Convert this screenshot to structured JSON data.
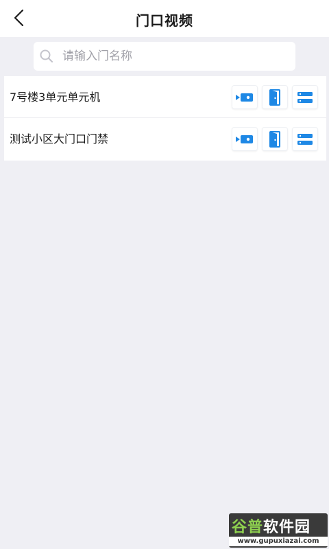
{
  "header": {
    "title": "门口视频",
    "back_icon": "chevron-left-icon"
  },
  "search": {
    "placeholder": "请输入门名称",
    "value": "",
    "icon": "search-icon"
  },
  "doors": [
    {
      "name": "7号楼3单元单元机"
    },
    {
      "name": "测试小区大门口门禁"
    }
  ],
  "actions": {
    "video_icon": "video-camera-icon",
    "door_icon": "open-door-icon",
    "more_icon": "list-menu-icon"
  },
  "colors": {
    "accent": "#1e88e5",
    "background": "#efeff4"
  },
  "watermark": {
    "brand_a": "谷普",
    "brand_b": "软件园",
    "url": "www.gupuxiazai.com"
  }
}
